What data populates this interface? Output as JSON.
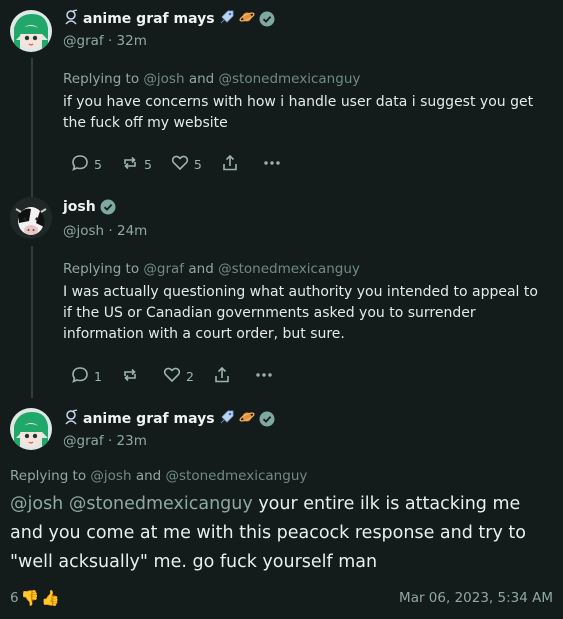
{
  "posts": [
    {
      "display_name": "anime graf mays",
      "handle": "@graf",
      "time": "32m",
      "reply_prefix": "Replying to",
      "reply_to_1": "@josh",
      "reply_and": "and",
      "reply_to_2": "@stonedmexicanguy",
      "body": "if you have concerns with how i handle user data i suggest you get the fuck off my website",
      "replies": "5",
      "reposts": "5",
      "likes": "5"
    },
    {
      "display_name": "josh",
      "handle": "@josh",
      "time": "24m",
      "reply_prefix": "Replying to",
      "reply_to_1": "@graf",
      "reply_and": "and",
      "reply_to_2": "@stonedmexicanguy",
      "body": "I was actually questioning what authority you intended to appeal to if the US or Canadian governments asked you to surrender information with a court order, but sure.",
      "replies": "1",
      "likes": "2"
    },
    {
      "display_name": "anime graf mays",
      "handle": "@graf",
      "time": "23m",
      "reply_prefix": "Replying to",
      "reply_to_1": "@josh",
      "reply_and": "and",
      "reply_to_2": "@stonedmexicanguy",
      "mention_1": "@josh",
      "mention_2": "@stonedmexicanguy",
      "body": "your entire ilk is attacking me and you come at me with this peacock response and try to \"well acksually\" me. go fuck yourself man",
      "reaction_count": "6",
      "reaction_1": "👎",
      "reaction_2": "👍",
      "timestamp": "Mar 06, 2023, 5:34 AM"
    }
  ],
  "separator": "·",
  "colors": {
    "background": "#141c1b",
    "text": "#e3ebe8",
    "muted": "#8fa8a2",
    "verified": "#7ea9a0"
  },
  "icons": [
    "rocket-icon",
    "planet-icon",
    "verified-badge-icon",
    "reply-icon",
    "repost-icon",
    "like-icon",
    "share-icon",
    "more-icon",
    "thumbs-down-emoji",
    "thumbs-up-emoji"
  ]
}
